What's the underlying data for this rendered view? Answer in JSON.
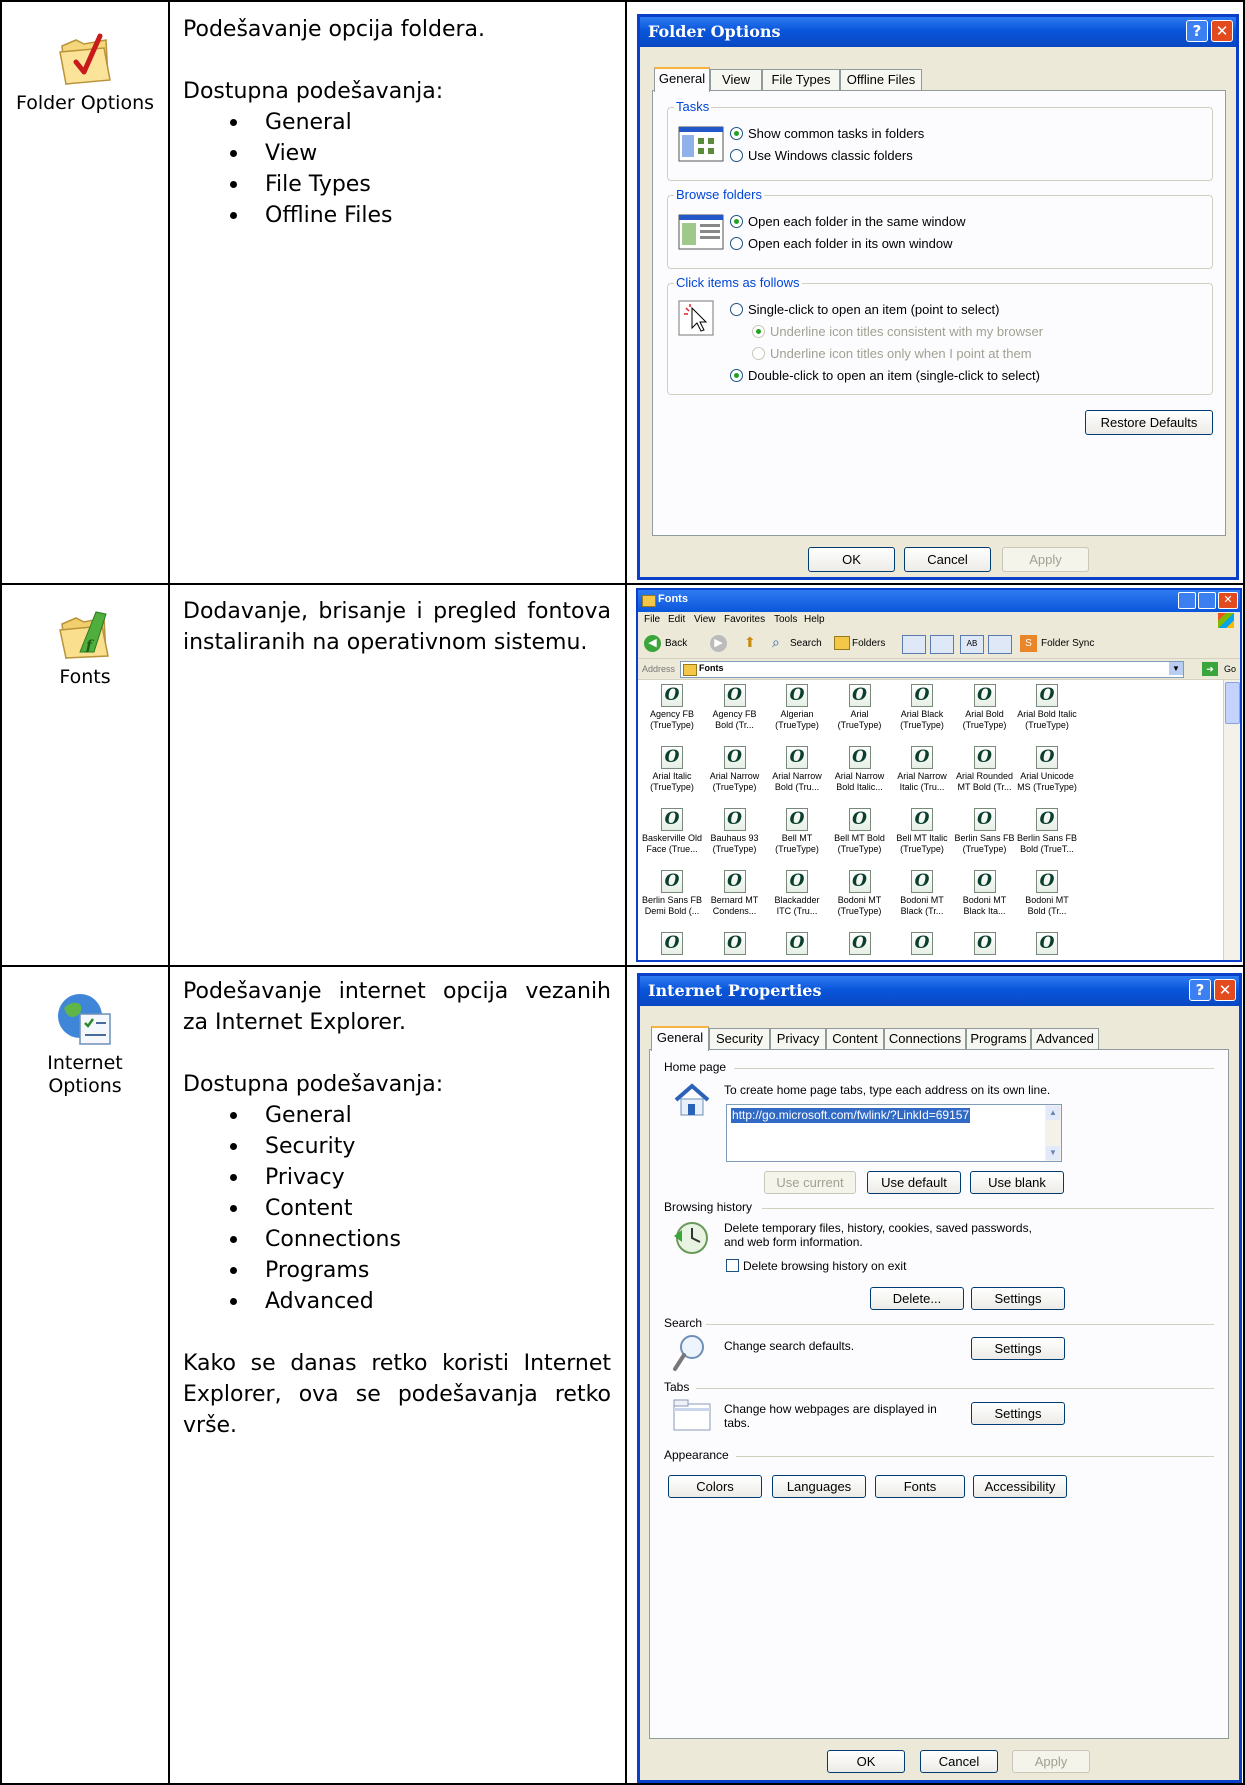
{
  "rows": [
    {
      "icon_label": "Folder Options",
      "description": "Podešavanje opcija foldera.",
      "sub_heading": "Dostupna podešavanja:",
      "bullets": [
        "General",
        "View",
        "File Types",
        "Offline Files"
      ]
    },
    {
      "icon_label": "Fonts",
      "description": "Dodavanje, brisanje i pregled fontova instaliranih na operativnom sistemu."
    },
    {
      "icon_label_line1": "Internet",
      "icon_label_line2": "Options",
      "description": "Podešavanje internet opcija vezanih za Internet Explorer.",
      "sub_heading": "Dostupna podešavanja:",
      "bullets": [
        "General",
        "Security",
        "Privacy",
        "Content",
        "Connections",
        "Programs",
        "Advanced"
      ],
      "footer": "Kako se danas retko koristi Internet Explorer, ova se podešavanja retko vrše."
    }
  ],
  "folder_dialog": {
    "title": "Folder Options",
    "help_glyph": "?",
    "close_glyph": "✕",
    "tabs": [
      "General",
      "View",
      "File Types",
      "Offline Files"
    ],
    "tasks_group": "Tasks",
    "tasks_opt1": "Show common tasks in folders",
    "tasks_opt2": "Use Windows classic folders",
    "browse_group": "Browse folders",
    "browse_opt1": "Open each folder in the same window",
    "browse_opt2": "Open each folder in its own window",
    "click_group": "Click items as follows",
    "click_opt1": "Single-click to open an item (point to select)",
    "click_sub1": "Underline icon titles consistent with my browser",
    "click_sub2": "Underline icon titles only when I point at them",
    "click_opt2": "Double-click to open an item (single-click to select)",
    "restore_btn": "Restore Defaults",
    "ok_btn": "OK",
    "cancel_btn": "Cancel",
    "apply_btn": "Apply"
  },
  "fonts_window": {
    "title": "Fonts",
    "menu": [
      "File",
      "Edit",
      "View",
      "Favorites",
      "Tools",
      "Help"
    ],
    "back": "Back",
    "search": "Search",
    "folders": "Folders",
    "folder_sync": "Folder Sync",
    "address_label": "Address",
    "address_value": "Fonts",
    "go": "Go",
    "icon_glyph": "O",
    "items": [
      [
        "Agency FB",
        "(TrueType)"
      ],
      [
        "Agency FB",
        "Bold (Tr..."
      ],
      [
        "Algerian",
        "(TrueType)"
      ],
      [
        "Arial",
        "(TrueType)"
      ],
      [
        "Arial Black",
        "(TrueType)"
      ],
      [
        "Arial Bold",
        "(TrueType)"
      ],
      [
        "Arial Bold Italic",
        "(TrueType)"
      ],
      [
        "Arial Italic",
        "(TrueType)"
      ],
      [
        "Arial Narrow",
        "(TrueType)"
      ],
      [
        "Arial Narrow",
        "Bold (Tru..."
      ],
      [
        "Arial Narrow",
        "Bold Italic..."
      ],
      [
        "Arial Narrow",
        "Italic (Tru..."
      ],
      [
        "Arial Rounded",
        "MT Bold (Tr..."
      ],
      [
        "Arial Unicode",
        "MS (TrueType)"
      ],
      [
        "Baskerville Old",
        "Face (True..."
      ],
      [
        "Bauhaus 93",
        "(TrueType)"
      ],
      [
        "Bell MT",
        "(TrueType)"
      ],
      [
        "Bell MT Bold",
        "(TrueType)"
      ],
      [
        "Bell MT Italic",
        "(TrueType)"
      ],
      [
        "Berlin Sans FB",
        "(TrueType)"
      ],
      [
        "Berlin Sans FB",
        "Bold (TrueT..."
      ],
      [
        "Berlin Sans FB",
        "Demi Bold (..."
      ],
      [
        "Bernard MT",
        "Condens..."
      ],
      [
        "Blackadder",
        "ITC (Tru..."
      ],
      [
        "Bodoni MT",
        "(TrueType)"
      ],
      [
        "Bodoni MT",
        "Black (Tr..."
      ],
      [
        "Bodoni MT",
        "Black Ita..."
      ],
      [
        "Bodoni MT",
        "Bold (Tr..."
      ],
      [
        "",
        ""
      ],
      [
        "",
        ""
      ],
      [
        "",
        ""
      ],
      [
        "",
        ""
      ],
      [
        "",
        ""
      ],
      [
        "",
        ""
      ],
      [
        "",
        ""
      ]
    ]
  },
  "ie_dialog": {
    "title": "Internet Properties",
    "help_glyph": "?",
    "close_glyph": "✕",
    "tabs": [
      "General",
      "Security",
      "Privacy",
      "Content",
      "Connections",
      "Programs",
      "Advanced"
    ],
    "home_section": "Home page",
    "home_text": "To create home page tabs, type each address on its own line.",
    "home_url": "http://go.microsoft.com/fwlink/?LinkId=69157",
    "use_current": "Use current",
    "use_default": "Use default",
    "use_blank": "Use blank",
    "history_section": "Browsing history",
    "history_text1": "Delete temporary files, history, cookies, saved passwords,",
    "history_text2": "and web form information.",
    "history_checkbox": "Delete browsing history on exit",
    "delete_btn": "Delete...",
    "settings_btn": "Settings",
    "search_section": "Search",
    "search_text": "Change search defaults.",
    "tabs_section": "Tabs",
    "tabs_text1": "Change how webpages are displayed in",
    "tabs_text2": "tabs.",
    "appearance_section": "Appearance",
    "colors_btn": "Colors",
    "languages_btn": "Languages",
    "fonts_btn": "Fonts",
    "accessibility_btn": "Accessibility",
    "ok_btn": "OK",
    "cancel_btn": "Cancel",
    "apply_btn": "Apply"
  }
}
